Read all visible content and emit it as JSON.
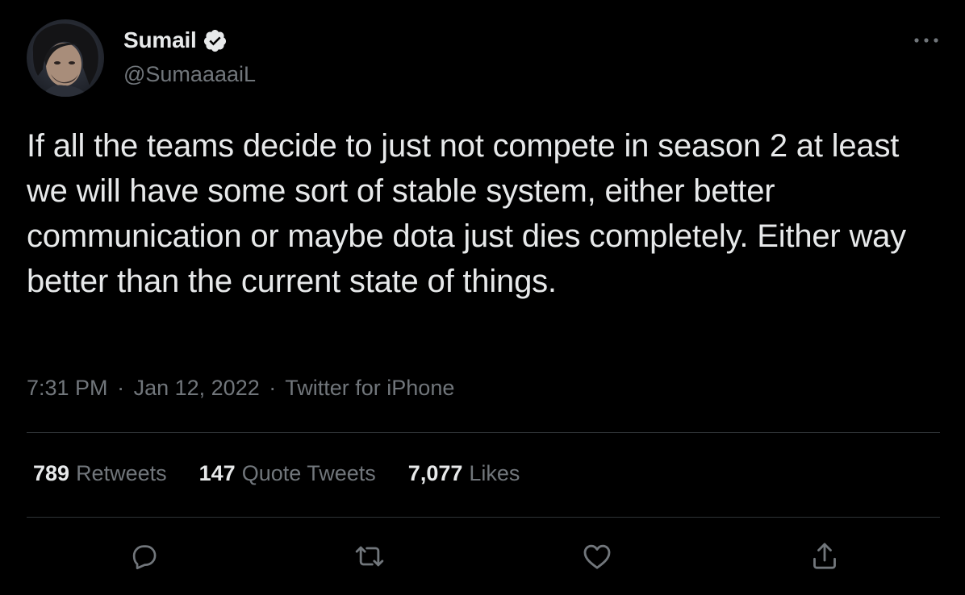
{
  "author": {
    "display_name": "Sumail",
    "handle": "@SumaaaaiL",
    "verified": true,
    "avatar_icon": "avatar-photo-icon"
  },
  "tweet": {
    "text": "If all the teams decide to just not compete in season 2 at least we will have some sort of stable system, either better communication or maybe dota just dies completely. Either way better than the current state of things.",
    "time": "7:31 PM",
    "date": "Jan 12, 2022",
    "source": "Twitter for iPhone",
    "separator": "·"
  },
  "stats": {
    "retweets": {
      "count": "789",
      "label": "Retweets"
    },
    "quote_tweets": {
      "count": "147",
      "label": "Quote Tweets"
    },
    "likes": {
      "count": "7,077",
      "label": "Likes"
    }
  },
  "actions": [
    "reply-icon",
    "retweet-icon",
    "like-icon",
    "share-icon"
  ],
  "colors": {
    "background": "#000000",
    "primary_text": "#e7e9ea",
    "secondary_text": "#71767b",
    "divider": "#2f3336"
  }
}
